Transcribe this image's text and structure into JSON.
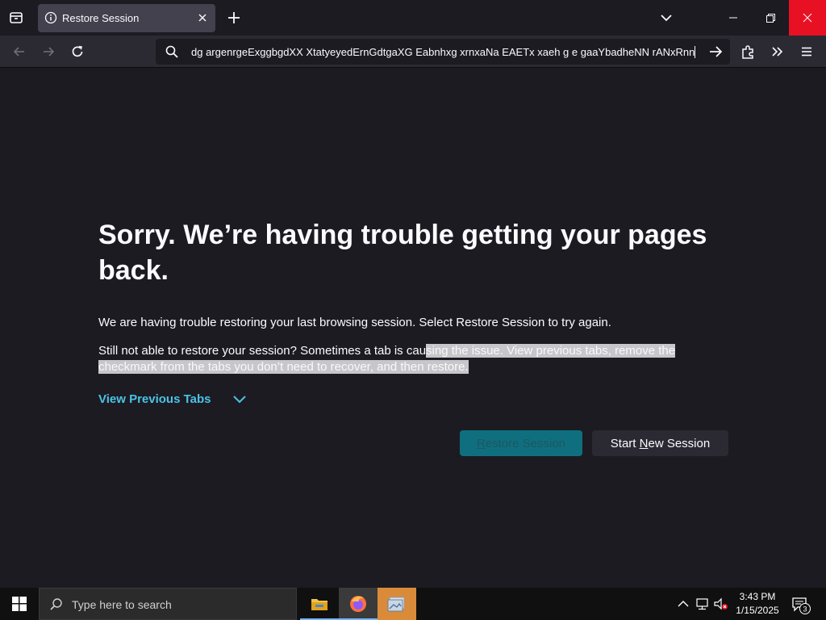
{
  "tab": {
    "title": "Restore Session"
  },
  "navbar": {
    "url": "dg argenrgeExggbgdXX XtatyeyedErnGdtgaXG Eabnhxg xrnxaNa EAETx xaeh g e gaaYbadheNN rANxRnn"
  },
  "content": {
    "heading": "Sorry. We’re having trouble getting your pages back.",
    "para1": "We are having trouble restoring your last browsing session. Select Restore Session to try again.",
    "para2_plain": "Still not able to restore your session? Sometimes a tab is cau",
    "para2_selected": "sing the issue. View previous tabs, remove the checkmark from the tabs you don’t need to recover, and then restore.",
    "view_previous_tabs": "View Previous Tabs",
    "restore_button": {
      "before": "",
      "accesskey": "R",
      "after": "estore Session"
    },
    "new_session_button": {
      "before": "Start ",
      "accesskey": "N",
      "after": "ew Session"
    }
  },
  "taskbar": {
    "search_placeholder": "Type here to search",
    "time": "3:43 PM",
    "date": "1/15/2025",
    "notification_count": "3"
  },
  "colors": {
    "accent": "#4cc3e6",
    "primary_button": "#0f6f7f",
    "close_button": "#e81123"
  }
}
